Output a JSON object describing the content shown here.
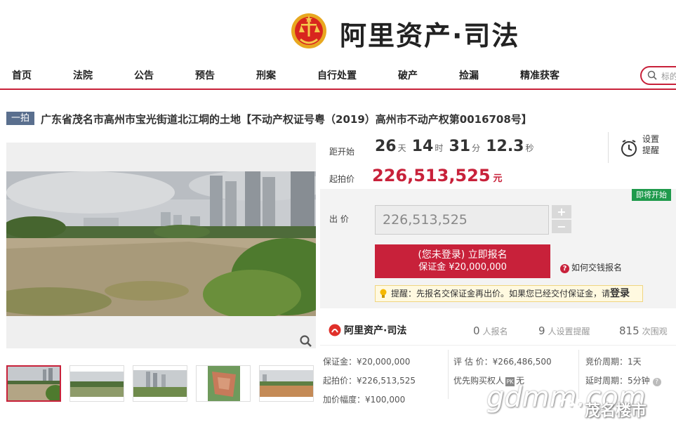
{
  "header": {
    "logo_text": "阿里资产·司法"
  },
  "nav": {
    "items": [
      "首页",
      "法院",
      "公告",
      "预告",
      "刑案",
      "自行处置",
      "破产",
      "捡漏",
      "精准获客"
    ],
    "search_placeholder": "标的"
  },
  "item": {
    "badge": "一拍",
    "title": "广东省茂名市高州市宝光街道北江垌的土地【不动产权证号粤（2019）高州市不动产权第0016708号】"
  },
  "countdown": {
    "label": "距开始",
    "days": "26",
    "days_unit": "天",
    "hours": "14",
    "hours_unit": "时",
    "minutes": "31",
    "minutes_unit": "分",
    "seconds": "12.3",
    "seconds_unit": "秒"
  },
  "reminder": {
    "label": "设置提醒"
  },
  "start_price": {
    "label": "起拍价",
    "value": "226,513,525",
    "unit": "元"
  },
  "bid": {
    "status": "即将开始",
    "label": "出 价",
    "input_value": "226,513,525",
    "plus": "+",
    "minus": "−",
    "signup_line1": "(您未登录) 立即报名",
    "signup_line2": "保证金 ¥20,000,000",
    "how_to": "如何交钱报名",
    "tip": "提醒：先报名交保证金再出价。如果您已经交付保证金，请",
    "tip_login": "登录"
  },
  "stats": {
    "brand": "阿里资产·司法",
    "signups_num": "0",
    "signups_label": "人报名",
    "reminders_num": "9",
    "reminders_label": "人设置提醒",
    "views_num": "815",
    "views_label": "次围观"
  },
  "details": {
    "deposit": "保证金：¥20,000,000",
    "start_price": "起拍价：¥226,513,525",
    "increment": "加价幅度：¥100,000",
    "appraisal": "评 估 价：¥266,486,500",
    "priority": "优先购买权人",
    "priority_mark": "PK",
    "priority_value": "无",
    "cycle": "竞价周期：1天",
    "extension": "延时周期：5分钟"
  },
  "watermark": {
    "text": "gdmm.com",
    "account": "茂名楼市"
  },
  "colors": {
    "accent": "#c8213a",
    "badge": "#5a6f8e",
    "status": "#1f9a4c"
  }
}
